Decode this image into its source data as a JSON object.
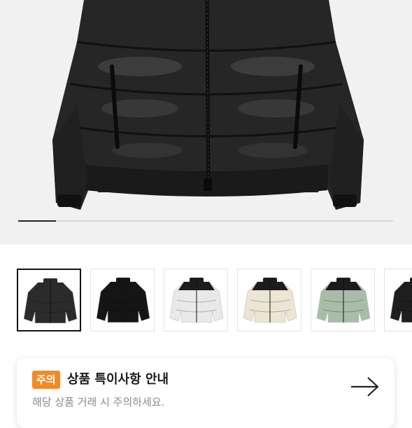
{
  "gallery": {
    "progress": 0.1,
    "image_icon": "black-puffer-jacket",
    "thumbnails": [
      {
        "name": "black-matte-jacket",
        "color": "#2b2b2b",
        "selected": true
      },
      {
        "name": "black-glossy-jacket",
        "color": "#151515",
        "selected": false
      },
      {
        "name": "white-jacket",
        "color": "#e9e9e9",
        "selected": false
      },
      {
        "name": "cream-jacket",
        "color": "#ebe5d2",
        "selected": false
      },
      {
        "name": "sage-green-jacket",
        "color": "#a9bca8",
        "selected": false
      },
      {
        "name": "black-jacket-partial",
        "color": "#1e1e1e",
        "selected": false
      }
    ]
  },
  "notice": {
    "badge": "주의",
    "title": "상품 특이사항 안내",
    "description": "해당 상품 거래 시 주의하세요.",
    "arrow_icon": "arrow-right-icon"
  },
  "colors": {
    "badge": "#f28a26",
    "hero_bg": "#f1f1f1"
  }
}
